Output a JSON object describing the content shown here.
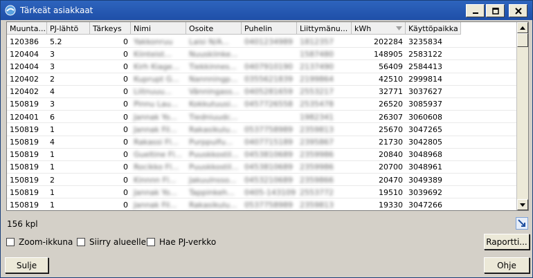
{
  "window": {
    "title": "Tärkeät asiakkaat"
  },
  "table": {
    "headers": [
      "Muunta...",
      "PJ-lähtö",
      "Tärkeys",
      "Nimi",
      "Osoite",
      "Puhelin",
      "Liittymänu...",
      "kWh",
      "Käyttöpaikka"
    ],
    "rows": [
      [
        "120386",
        "5.2",
        "0",
        "Yakkonruu",
        "Laisi N/A...",
        "0401234989",
        "1812357",
        "202284",
        "3235834"
      ],
      [
        "120404",
        "3",
        "0",
        "Kiinteist...",
        "Nuuskiinke...",
        "",
        "1587480",
        "148905",
        "2583122"
      ],
      [
        "120404",
        "3",
        "0",
        "Kirh Kiage...",
        "Tiekkinnes...",
        "0407910190",
        "2137490",
        "56409",
        "2584413"
      ],
      [
        "120402",
        "2",
        "0",
        "Kuprupt G...",
        "Nannningp...",
        "0355621839",
        "2199864",
        "42510",
        "2999814"
      ],
      [
        "120402",
        "4",
        "0",
        "Liitnuuu...",
        "Vänningass...",
        "0405281659",
        "2553217",
        "32771",
        "3037627"
      ],
      [
        "150819",
        "3",
        "0",
        "Pinnu Lau...",
        "Kokkutuusi...",
        "0457726558",
        "2535478",
        "26520",
        "3085937"
      ],
      [
        "120401",
        "6",
        "0",
        "Jannak Yo...",
        "Tiedniuudc...",
        "",
        "1982341",
        "26307",
        "3060608"
      ],
      [
        "150819",
        "1",
        "0",
        "Jannak Fil...",
        "Rakasikulu...",
        "0537758989",
        "2359813",
        "25670",
        "3047265"
      ],
      [
        "150819",
        "4",
        "0",
        "Rakassi Fl...",
        "Purppulfu...",
        "0407715189",
        "2395867",
        "21730",
        "3042805"
      ],
      [
        "150819",
        "1",
        "0",
        "Gueltine Fl...",
        "Puuskkostil...",
        "0453810689",
        "2359986",
        "20840",
        "3048968"
      ],
      [
        "150819",
        "1",
        "0",
        "Rocikko Fl...",
        "Puuskkostil...",
        "0453810689",
        "2359986",
        "20700",
        "3048961"
      ],
      [
        "150819",
        "2",
        "0",
        "Kinnnn Fl...",
        "Jakuulnsso...",
        "0453210689",
        "2359866",
        "20470",
        "3049389"
      ],
      [
        "150819",
        "1",
        "0",
        "Jannak Yo...",
        "Tappinkeh...",
        "0405-143109",
        "2553772",
        "19510",
        "3039692"
      ],
      [
        "150819",
        "1",
        "0",
        "Jannak Fil...",
        "Rakasikulu...",
        "0537758989",
        "2359813",
        "19330",
        "3047266"
      ]
    ]
  },
  "status": {
    "count_label": "156 kpl"
  },
  "options": {
    "zoom_label": "Zoom-ikkuna",
    "move_area_label": "Siirry alueelle",
    "fetch_network_label": "Hae PJ-verkko"
  },
  "buttons": {
    "report": "Raportti...",
    "close": "Sulje",
    "help": "Ohje"
  },
  "colors": {
    "title_bar": "#2e64bd",
    "window_bg": "#d4d0c8"
  }
}
